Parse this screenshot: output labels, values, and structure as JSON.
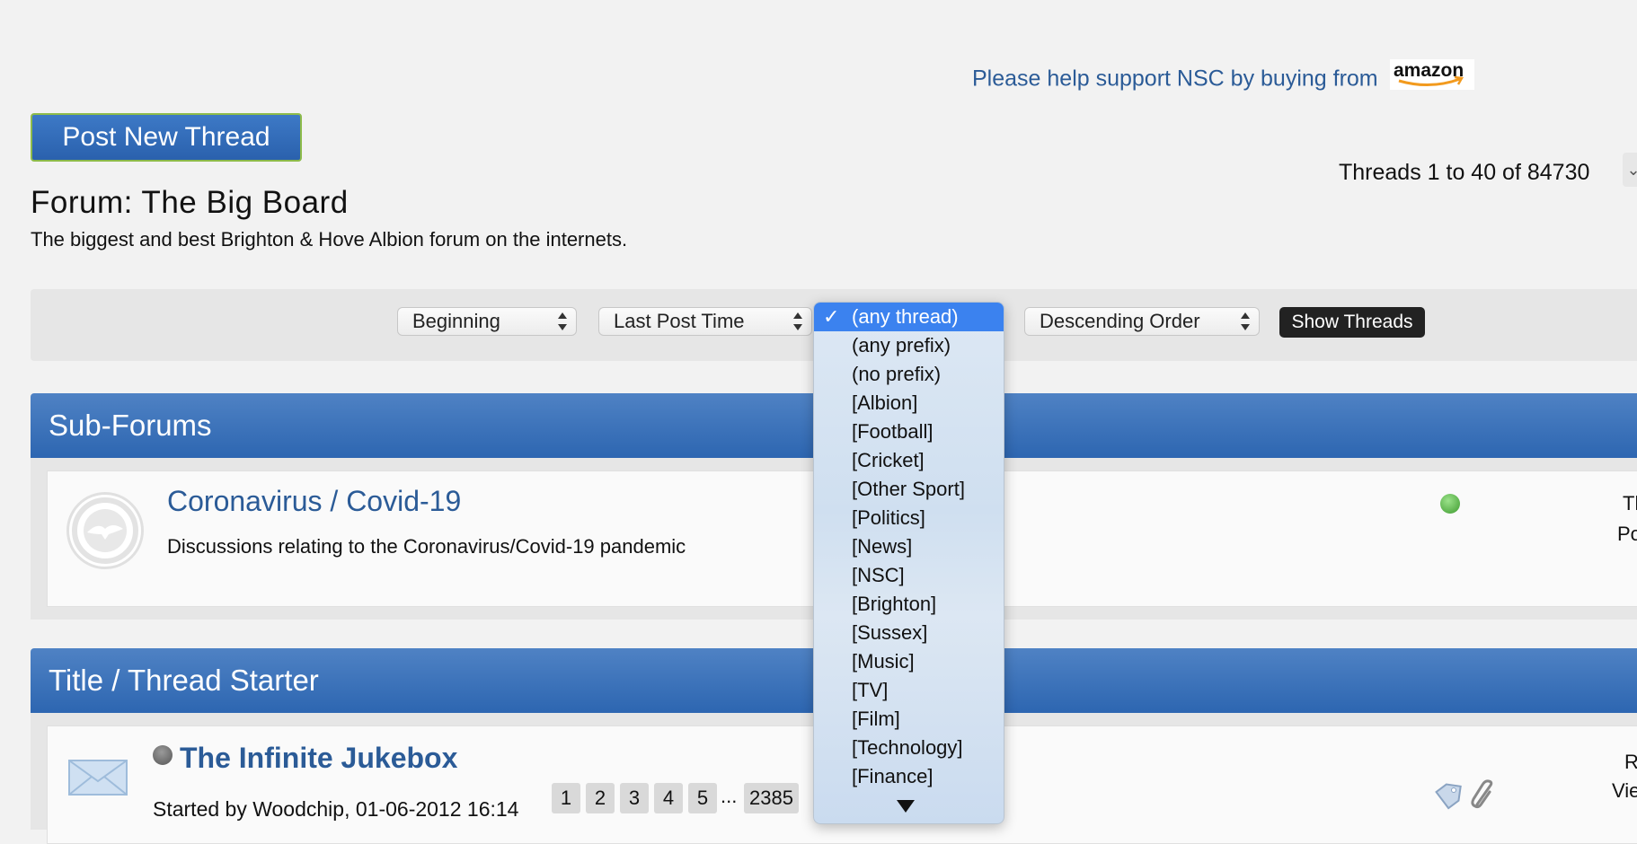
{
  "promo": {
    "text": "Please help support NSC by buying from",
    "logo_text": "amazon"
  },
  "toolbar": {
    "post_new_thread": "Post New Thread"
  },
  "pagination_info": "Threads 1 to 40 of 84730",
  "forum": {
    "title": "Forum: The Big Board",
    "description": "The biggest and best Brighton & Hove Albion forum on the internets."
  },
  "filters": {
    "from": "Beginning",
    "sort_by": "Last Post Time",
    "order": "Descending Order",
    "show_button": "Show Threads",
    "prefix": {
      "selected": "(any thread)",
      "options": [
        "(any thread)",
        "(any prefix)",
        "(no prefix)",
        "[Albion]",
        "[Football]",
        "[Cricket]",
        "[Other Sport]",
        "[Politics]",
        "[News]",
        "[NSC]",
        "[Brighton]",
        "[Sussex]",
        "[Music]",
        "[TV]",
        "[Film]",
        "[Technology]",
        "[Finance]"
      ]
    }
  },
  "subforums": {
    "header": "Sub-Forums",
    "items": [
      {
        "title": "Coronavirus / Covid-19",
        "description": "Discussions relating to the Coronavirus/Covid-19 pandemic",
        "status": "active",
        "edge_line1": "Th",
        "edge_line2": "Po"
      }
    ]
  },
  "threads": {
    "header": "Title / Thread Starter",
    "items": [
      {
        "title": "The Infinite Jukebox",
        "starter": "Started by Woodchip, 01-06-2012 16:14",
        "pages": [
          "1",
          "2",
          "3",
          "4",
          "5"
        ],
        "ellipsis": "...",
        "last_page": "2385",
        "edge_line1": "R",
        "edge_line2": "Vie"
      }
    ]
  },
  "colors": {
    "link": "#2b5b97",
    "header_blue": "#3d72ba",
    "selected": "#3b82ef",
    "button_border": "#8dbb4a"
  },
  "icons": [
    "amazon-logo",
    "select-arrows-icon",
    "checkmark-icon",
    "scroll-down-arrow-icon",
    "forum-logo-icon",
    "status-online-icon",
    "envelope-icon",
    "thread-status-icon",
    "tag-icon",
    "paperclip-icon"
  ]
}
